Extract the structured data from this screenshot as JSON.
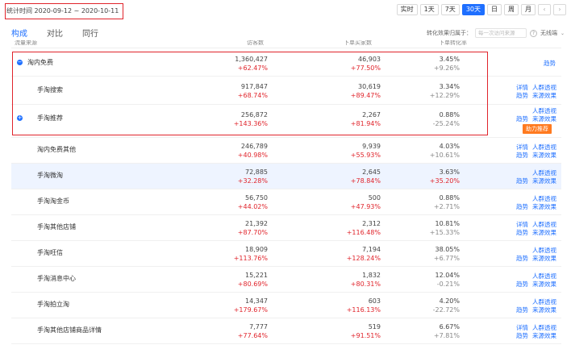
{
  "header": {
    "date_range": "统计时间 2020-09-12 ~ 2020-10-11",
    "period_buttons": [
      "实时",
      "1天",
      "7天",
      "30天",
      "日",
      "周",
      "月"
    ],
    "active_period": "30天",
    "prev_arrow": "‹",
    "next_arrow": "›"
  },
  "tabs": [
    {
      "label": "构成",
      "active": true
    },
    {
      "label": "对比",
      "active": false
    },
    {
      "label": "同行",
      "active": false
    }
  ],
  "conversion": {
    "label": "转化效果归属于：",
    "placeholder": "每一次访问来源",
    "help": "?",
    "wireless": "无线端",
    "chevron": "⌄"
  },
  "table": {
    "headers": [
      "流量来源",
      "访客数",
      "下单买家数",
      "下单转化率"
    ],
    "rows": [
      {
        "name": "淘内免费",
        "level": 1,
        "expand": "−",
        "visitors": "1,360,427",
        "visitors_change": "+62.47%",
        "buyers": "46,903",
        "buyers_change": "+77.50%",
        "rate": "3.45%",
        "rate_change": "+9.26%",
        "links": [
          "趋势"
        ],
        "tag": ""
      },
      {
        "name": "手淘搜索",
        "level": 2,
        "expand": "",
        "visitors": "917,847",
        "visitors_change": "+68.74%",
        "buyers": "30,619",
        "buyers_change": "+89.47%",
        "rate": "3.34%",
        "rate_change": "+12.29%",
        "links": [
          "详情",
          "人群透视",
          "趋势",
          "来源效果"
        ],
        "tag": ""
      },
      {
        "name": "手淘推荐",
        "level": 2,
        "expand": "+",
        "visitors": "256,872",
        "visitors_change": "+143.36%",
        "buyers": "2,267",
        "buyers_change": "+81.94%",
        "rate": "0.88%",
        "rate_change": "-25.24%",
        "links": [
          "人群透视",
          "趋势",
          "来源效果"
        ],
        "tag": "助力推荐"
      },
      {
        "name": "淘内免费其他",
        "level": 2,
        "expand": "",
        "visitors": "246,789",
        "visitors_change": "+40.98%",
        "buyers": "9,939",
        "buyers_change": "+55.93%",
        "rate": "4.03%",
        "rate_change": "+10.61%",
        "links": [
          "详情",
          "人群透视",
          "趋势",
          "来源效果"
        ],
        "tag": ""
      },
      {
        "name": "手淘微淘",
        "level": 2,
        "expand": "",
        "visitors": "72,885",
        "visitors_change": "+32.28%",
        "buyers": "2,645",
        "buyers_change": "+78.84%",
        "rate": "3.63%",
        "rate_change": "+35.20%",
        "links": [
          "人群透视",
          "趋势",
          "来源效果"
        ],
        "tag": ""
      },
      {
        "name": "手淘淘金币",
        "level": 2,
        "expand": "",
        "visitors": "56,750",
        "visitors_change": "+44.02%",
        "buyers": "500",
        "buyers_change": "+47.93%",
        "rate": "0.88%",
        "rate_change": "+2.71%",
        "links": [
          "人群透视",
          "趋势",
          "来源效果"
        ],
        "tag": ""
      },
      {
        "name": "手淘其他店铺",
        "level": 2,
        "expand": "",
        "visitors": "21,392",
        "visitors_change": "+87.70%",
        "buyers": "2,312",
        "buyers_change": "+116.48%",
        "rate": "10.81%",
        "rate_change": "+15.33%",
        "links": [
          "详情",
          "人群透视",
          "趋势",
          "来源效果"
        ],
        "tag": ""
      },
      {
        "name": "手淘旺信",
        "level": 2,
        "expand": "",
        "visitors": "18,909",
        "visitors_change": "+113.76%",
        "buyers": "7,194",
        "buyers_change": "+128.24%",
        "rate": "38.05%",
        "rate_change": "+6.77%",
        "links": [
          "人群透视",
          "趋势",
          "来源效果"
        ],
        "tag": ""
      },
      {
        "name": "手淘消息中心",
        "level": 2,
        "expand": "",
        "visitors": "15,221",
        "visitors_change": "+80.69%",
        "buyers": "1,832",
        "buyers_change": "+80.31%",
        "rate": "12.04%",
        "rate_change": "-0.21%",
        "links": [
          "人群透视",
          "趋势",
          "来源效果"
        ],
        "tag": ""
      },
      {
        "name": "手淘拍立淘",
        "level": 2,
        "expand": "",
        "visitors": "14,347",
        "visitors_change": "+179.67%",
        "buyers": "603",
        "buyers_change": "+116.13%",
        "rate": "4.20%",
        "rate_change": "-22.72%",
        "links": [
          "人群透视",
          "趋势",
          "来源效果"
        ],
        "tag": ""
      },
      {
        "name": "手淘其他店铺商品详情",
        "level": 2,
        "expand": "",
        "visitors": "7,777",
        "visitors_change": "+77.64%",
        "buyers": "519",
        "buyers_change": "+91.51%",
        "rate": "6.67%",
        "rate_change": "+7.81%",
        "links": [
          "详情",
          "人群透视",
          "趋势",
          "来源效果"
        ],
        "tag": ""
      }
    ]
  },
  "colors": {
    "accent": "#1e6fff",
    "positive": "#e0242b",
    "highlight_box": "#e0242b",
    "tag": "#ff7a1f",
    "row_highlight": "#eef4ff"
  }
}
